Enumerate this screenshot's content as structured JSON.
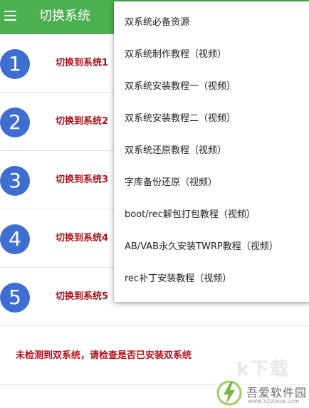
{
  "app_bar": {
    "title": "切换系统",
    "menu_icon": "hamburger-menu-icon",
    "background_color": "#4caf50"
  },
  "systems": [
    {
      "number": "1",
      "label": "切换到系统1"
    },
    {
      "number": "2",
      "label": "切换到系统2"
    },
    {
      "number": "3",
      "label": "切换到系统3"
    },
    {
      "number": "4",
      "label": "切换到系统4"
    },
    {
      "number": "5",
      "label": "切换到系统5"
    }
  ],
  "status_message": "未检测到双系统，请检查是否已安装双系统",
  "dropdown_menu": {
    "items": [
      "双系统必备资源",
      "双系统制作教程（视频）",
      "双系统安装教程一（视频）",
      "双系统安装教程二（视频）",
      "双系统还原教程（视频）",
      "字库备份还原（视频）",
      "boot/rec解包打包教程（视频）",
      "AB/VAB永久安装TWRP教程（视频）",
      "rec补丁安装教程（视频）"
    ]
  },
  "watermark": {
    "big_text": "k下载",
    "title": "吾爱软件园",
    "url": "www.52zixue.com"
  },
  "colors": {
    "circle": "#3f6ed1",
    "label": "#a8131a",
    "status": "#b3121b"
  }
}
